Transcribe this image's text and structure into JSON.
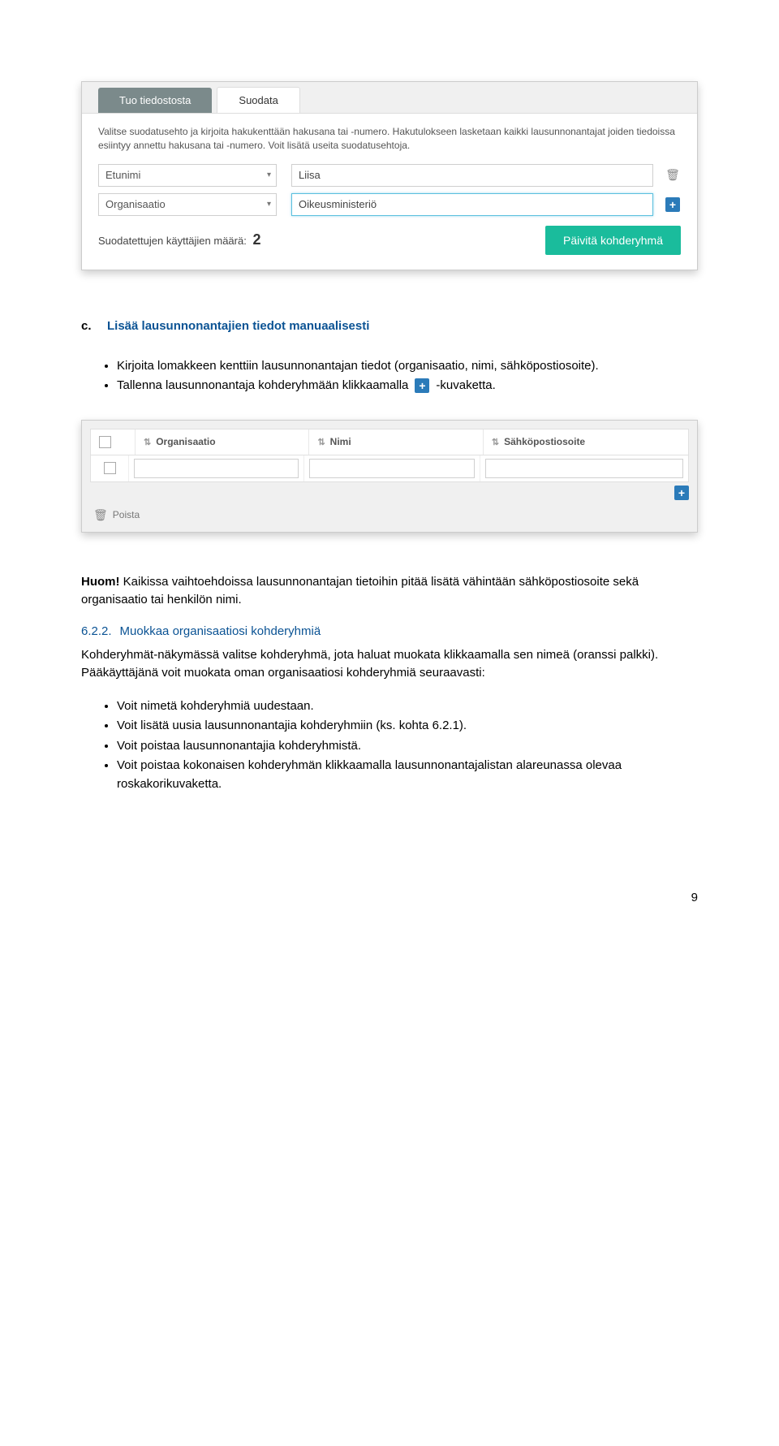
{
  "shot1": {
    "tab1": "Tuo tiedostosta",
    "tab2": "Suodata",
    "help": "Valitse suodatusehto ja kirjoita hakukenttään hakusana tai -numero. Hakutulokseen lasketaan kaikki lausunnonantajat joiden tiedoissa esiintyy annettu hakusana tai -numero. Voit lisätä useita suodatusehtoja.",
    "field1": "Etunimi",
    "value1": "Liisa",
    "field2": "Organisaatio",
    "value2": "Oikeusministeriö",
    "countLabel": "Suodatettujen käyttäjien määrä:",
    "countValue": "2",
    "button": "Päivitä kohderyhmä"
  },
  "secC": {
    "mark": "c.",
    "title": "Lisää lausunnonantajien tiedot manuaalisesti",
    "b1": "Kirjoita lomakkeen kenttiin lausunnonantajan tiedot (organisaatio, nimi, sähköpostiosoite).",
    "b2a": "Tallenna lausunnonantaja kohderyhmään klikkaamalla",
    "b2b": "-kuvaketta."
  },
  "shot2": {
    "col1": "Organisaatio",
    "col2": "Nimi",
    "col3": "Sähköpostiosoite",
    "poista": "Poista"
  },
  "huom": {
    "label": "Huom!",
    "text": " Kaikissa vaihtoehdoissa lausunnonantajan tietoihin pitää lisätä vähintään sähköpostiosoite sekä organisaatio tai henkilön nimi."
  },
  "h622": {
    "num": "6.2.2.",
    "title": "Muokkaa organisaatiosi kohderyhmiä",
    "p1": "Kohderyhmät-näkymässä valitse kohderyhmä, jota haluat muokata klikkaamalla sen nimeä (oranssi palkki). Pääkäyttäjänä voit muokata oman organisaatiosi kohderyhmiä seuraavasti:",
    "b1": "Voit nimetä kohderyhmiä uudestaan.",
    "b2": "Voit lisätä uusia lausunnonantajia kohderyhmiin (ks. kohta 6.2.1).",
    "b3": "Voit poistaa lausunnonantajia kohderyhmistä.",
    "b4": "Voit poistaa kokonaisen kohderyhmän klikkaamalla lausunnonantajalistan alareunassa olevaa roskakorikuvaketta."
  },
  "pagenum": "9"
}
